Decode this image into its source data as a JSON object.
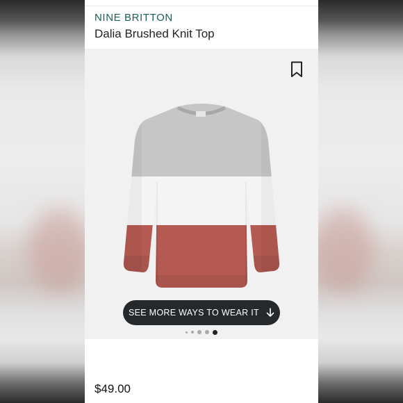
{
  "product": {
    "brand": "NINE BRITTON",
    "name": "Dalia Brushed Knit Top",
    "price": "$49.00"
  },
  "image": {
    "bookmark_icon": "bookmark-icon",
    "colors": {
      "top_band": "#c6c6c6",
      "middle_band": "#f4f4f4",
      "bottom_band": "#b45a52"
    }
  },
  "actions": {
    "see_more_label": "SEE MORE WAYS TO WEAR IT",
    "see_more_icon": "arrow-down-icon"
  },
  "carousel": {
    "total": 5,
    "active_index": 5
  }
}
